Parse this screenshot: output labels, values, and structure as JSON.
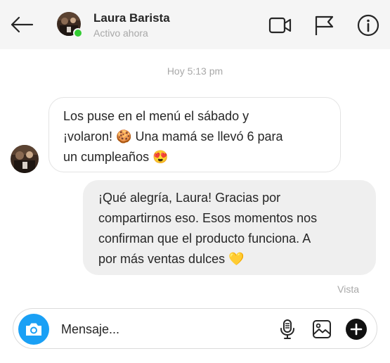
{
  "header": {
    "name": "Laura Barista",
    "status": "Activo ahora",
    "icons": [
      "back-arrow-icon",
      "video-camera-icon",
      "flag-icon",
      "info-icon"
    ],
    "online_color": "#33cc33"
  },
  "conversation": {
    "timestamp": "Hoy 5:13 pm",
    "messages": [
      {
        "direction": "incoming",
        "lines": [
          "Los puse en el menú el sábado y",
          "¡volaron! 🍪 Una mamá se llevó 6 para",
          "un cumpleaños 😍"
        ]
      },
      {
        "direction": "outgoing",
        "lines": [
          "¡Qué alegría, Laura! Gracias por",
          "compartirnos eso. Esos momentos nos",
          "confirman que el producto funciona. A",
          "por más ventas dulces 💛"
        ]
      }
    ],
    "seen": "Vista"
  },
  "composer": {
    "placeholder": "Mensaje...",
    "icons": [
      "camera-icon",
      "microphone-icon",
      "image-gallery-icon",
      "add-icon"
    ],
    "camera_color": "#1aa0f5"
  }
}
